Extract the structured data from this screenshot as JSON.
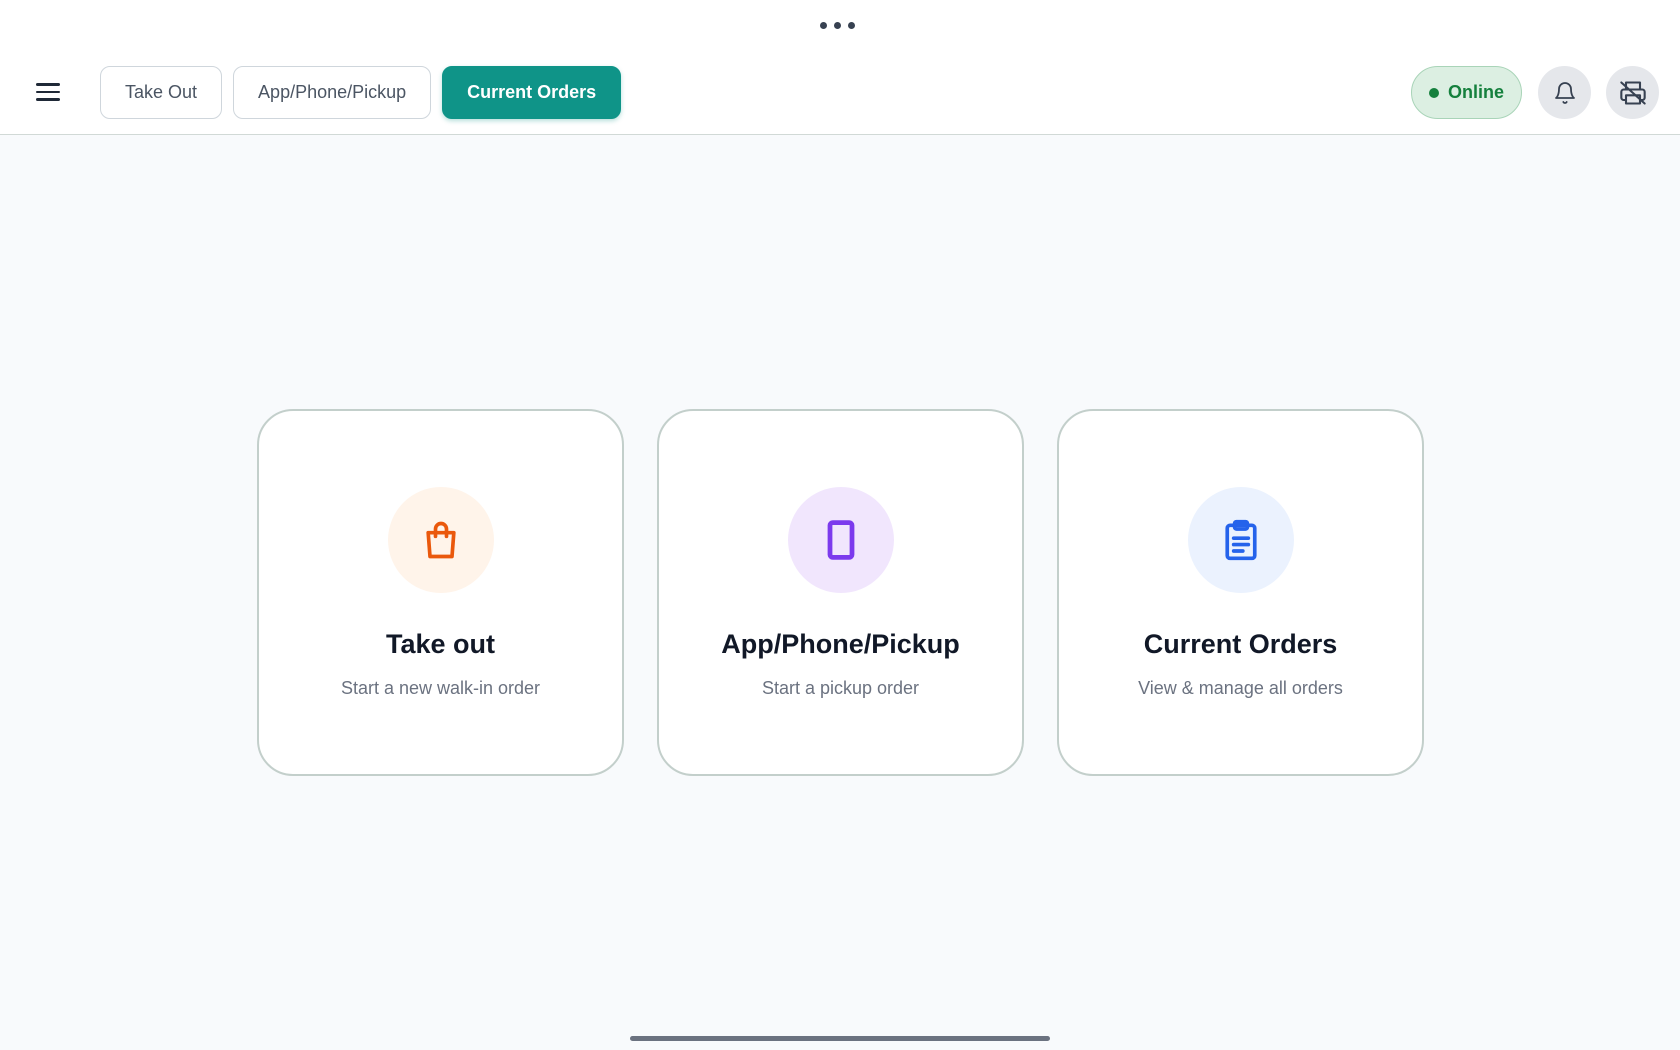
{
  "header": {
    "tabs": [
      {
        "label": "Take Out",
        "active": false
      },
      {
        "label": "App/Phone/Pickup",
        "active": false
      },
      {
        "label": "Current Orders",
        "active": true
      }
    ],
    "status": {
      "label": "Online",
      "color": "#15803d"
    },
    "icons": [
      "menu-icon",
      "bell-icon",
      "printer-off-icon"
    ]
  },
  "cards": [
    {
      "title": "Take out",
      "subtitle": "Start a new walk-in order",
      "icon": "shopping-bag-icon",
      "icon_color": "#ea580c",
      "icon_bg": "#fff4ea"
    },
    {
      "title": "App/Phone/Pickup",
      "subtitle": "Start a pickup order",
      "icon": "smartphone-icon",
      "icon_color": "#7c3aed",
      "icon_bg": "#f1e6fd"
    },
    {
      "title": "Current Orders",
      "subtitle": "View & manage all orders",
      "icon": "clipboard-icon",
      "icon_color": "#2563eb",
      "icon_bg": "#ebf2fe"
    }
  ],
  "colors": {
    "accent": "#0f9488",
    "background": "#f8fafc"
  }
}
